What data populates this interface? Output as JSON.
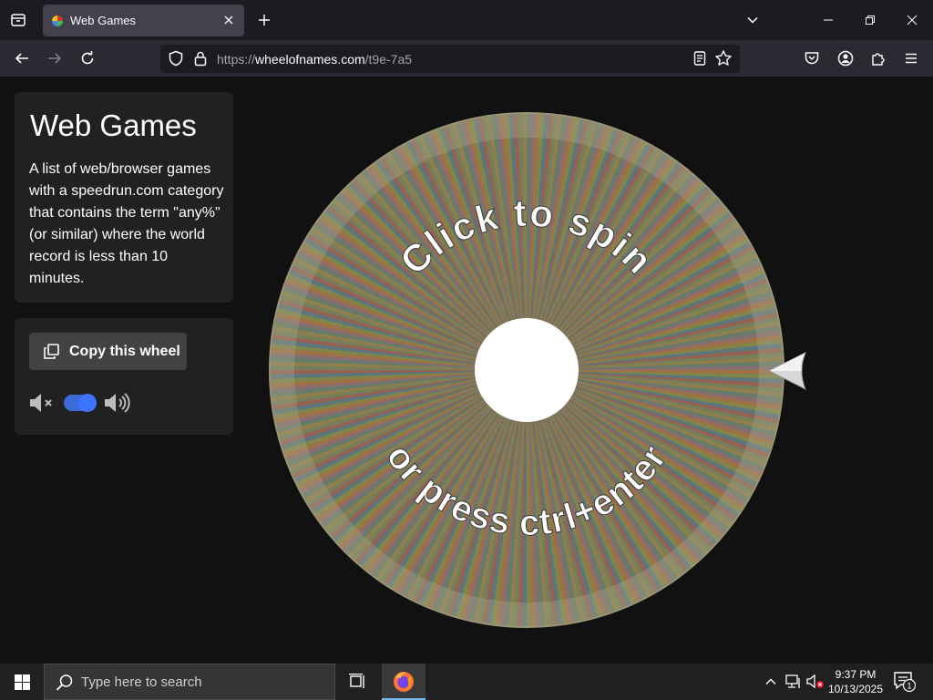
{
  "browser": {
    "tab_title": "Web Games",
    "url_prefix": "https://",
    "url_host": "wheelofnames.com",
    "url_path": "/t9e-7a5"
  },
  "sidebar": {
    "title": "Web Games",
    "description": "A list of web/browser games with a speedrun.com category that contains the term \"any%\" (or similar) where the world record is less than 10 minutes.",
    "copy_button_label": "Copy this wheel",
    "sound_toggle_on": true
  },
  "wheel": {
    "top_text": "Click to spin",
    "bottom_text": "or press ctrl+enter"
  },
  "taskbar": {
    "search_placeholder": "Type here to search",
    "time": "9:37 PM",
    "date": "10/13/2025",
    "notification_count": "1"
  },
  "colors": {
    "toggle_accent": "#3d73ff",
    "active_taskbar_indicator": "#76b9ed"
  }
}
